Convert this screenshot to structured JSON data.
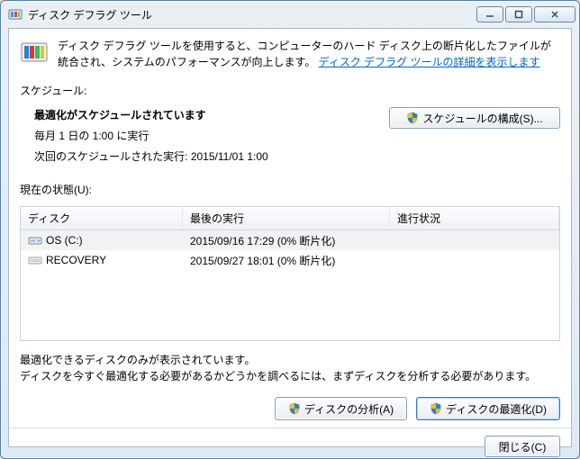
{
  "window": {
    "title": "ディスク デフラグ ツール"
  },
  "intro": {
    "text_before_link": "ディスク デフラグ ツールを使用すると、コンピューターのハード ディスク上の断片化したファイルが統合され、システムのパフォーマンスが向上します。",
    "link_text": "ディスク デフラグ ツールの詳細を表示します"
  },
  "schedule": {
    "section_label": "スケジュール:",
    "title": "最適化がスケジュールされています",
    "frequency": "毎月 1 日の 1:00 に実行",
    "next_run": "次回のスケジュールされた実行: 2015/11/01 1:00",
    "configure_button": "スケジュールの構成(S)..."
  },
  "status": {
    "section_label": "現在の状態(U):",
    "columns": {
      "disk": "ディスク",
      "last_run": "最後の実行",
      "progress": "進行状況"
    },
    "rows": [
      {
        "icon": "drive",
        "name": "OS (C:)",
        "last": "2015/09/16 17:29 (0% 断片化)",
        "progress": "",
        "selected": true
      },
      {
        "icon": "drive-alt",
        "name": "RECOVERY",
        "last": "2015/09/27 18:01 (0% 断片化)",
        "progress": "",
        "selected": false
      }
    ]
  },
  "note": {
    "line1": "最適化できるディスクのみが表示されています。",
    "line2": "ディスクを今すぐ最適化する必要があるかどうかを調べるには、まずディスクを分析する必要があります。"
  },
  "actions": {
    "analyze": "ディスクの分析(A)",
    "optimize": "ディスクの最適化(D)",
    "close": "閉じる(C)"
  },
  "colors": {
    "link": "#0066cc"
  }
}
